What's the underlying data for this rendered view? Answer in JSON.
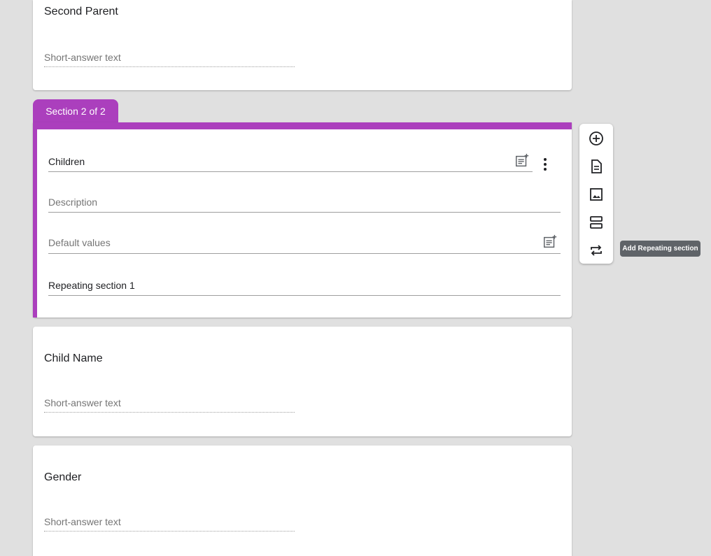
{
  "cards": {
    "second_parent": {
      "title": "Second Parent",
      "placeholder": "Short-answer text"
    },
    "child_name": {
      "title": "Child Name",
      "placeholder": "Short-answer text"
    },
    "gender": {
      "title": "Gender",
      "placeholder": "Short-answer text"
    }
  },
  "section": {
    "tab_label": "Section 2 of 2",
    "title_value": "Children",
    "description_placeholder": "Description",
    "default_values_placeholder": "Default values",
    "repeating_name": "Repeating section 1",
    "accent_color": "#ab3fbd"
  },
  "toolbar": {
    "items": [
      {
        "icon": "add-circle-icon"
      },
      {
        "icon": "title-description-icon"
      },
      {
        "icon": "image-icon"
      },
      {
        "icon": "section-icon"
      },
      {
        "icon": "repeat-icon"
      }
    ],
    "tooltip": "Add Repeating section"
  }
}
